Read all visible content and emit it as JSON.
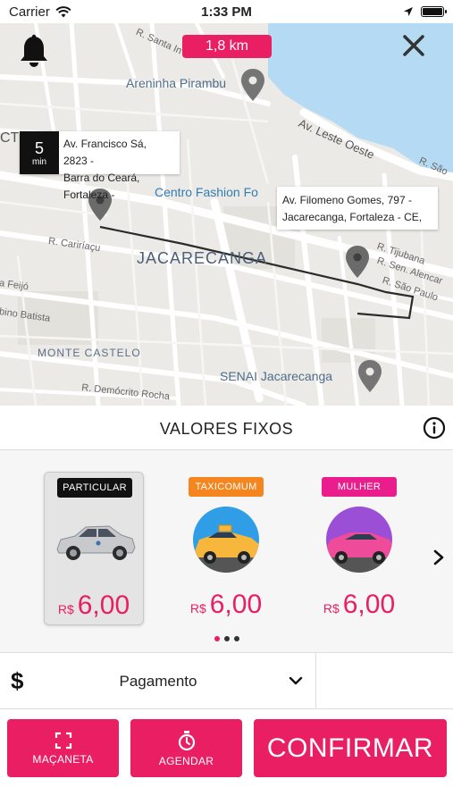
{
  "status_bar": {
    "carrier": "Carrier",
    "time": "1:33 PM"
  },
  "map": {
    "distance": "1,8 km",
    "eta": {
      "value": "5",
      "unit": "min"
    },
    "origin_address": [
      "Av. Francisco Sá, 2823 -",
      "Barra do Ceará, Fortaleza -"
    ],
    "destination_address": [
      "Av. Filomeno Gomes, 797 -",
      "Jacarecanga, Fortaleza - CE,"
    ],
    "labels": {
      "district": "JACARECANGA",
      "area": "MONTE CASTELO",
      "poi_fashion": "Centro Fashion Fo",
      "poi_senai": "SENAI Jacarecanga",
      "poi_areninha": "Areninha Pirambu",
      "ct": "CT",
      "av_leste_oeste": "Av. Leste Oeste",
      "r_santa": "R. Santa In",
      "r_sao": "R. São",
      "r_cariri": "R. Cariríaçu",
      "r_feijo": "a Feijó",
      "r_batista": "bino Batista",
      "r_tijubana": "R. Tijubana",
      "r_alencar": "R. Sen. Alencar",
      "r_sao_paulo": "R. São Paulo",
      "r_democrito": "R. Demócrito Rocha"
    }
  },
  "fixed_prices": {
    "title": "VALORES FIXOS",
    "options": [
      {
        "badge": "PARTICULAR",
        "badge_color": "#111111",
        "currency": "R$",
        "price": "6,00",
        "selected": true,
        "icon": "car-icon"
      },
      {
        "badge": "TAXICOMUM",
        "badge_color": "#f4851f",
        "currency": "R$",
        "price": "6,00",
        "selected": false,
        "icon": "taxi-icon"
      },
      {
        "badge": "MULHER",
        "badge_color": "#e91e8c",
        "currency": "R$",
        "price": "6,00",
        "selected": false,
        "icon": "pink-car-icon"
      }
    ],
    "page_indicator": {
      "count": 3,
      "active": 1
    }
  },
  "payment": {
    "symbol": "$",
    "label": "Pagamento"
  },
  "actions": {
    "handle_label": "MAÇANETA",
    "schedule_label": "AGENDAR",
    "confirm_label": "CONFIRMAR"
  },
  "colors": {
    "accent": "#e91e63",
    "map_bg": "#eceae6",
    "water": "#b4dbf3"
  }
}
